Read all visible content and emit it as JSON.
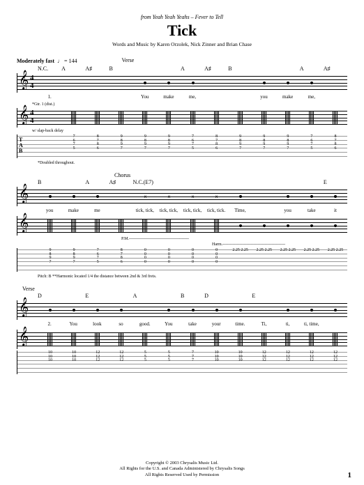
{
  "header": {
    "source": "from Yeah Yeah Yeahs – Fever to Tell",
    "title": "Tick",
    "credits": "Words and Music by Karen Orzolek, Nick Zinner and Brian Chase"
  },
  "tempo": {
    "label": "Moderately fast",
    "bpm": "♩ = 144"
  },
  "systems": [
    {
      "section": "Verse",
      "chords": [
        "N.C.",
        "A",
        "A♯",
        "B",
        "",
        "",
        "A",
        "A♯",
        "B",
        "",
        "",
        "A",
        "A♯"
      ],
      "lyric_prefix": "1.",
      "lyrics": [
        "",
        "",
        "",
        "",
        "You",
        "make",
        "me,",
        "",
        "",
        "you",
        "make",
        "me,",
        ""
      ],
      "perf": "*Gtr. 1 (dist.)",
      "perf2": "w/ slap-back delay",
      "tab_cols": [
        "",
        "7\n6\n7\n5",
        "8\n7\n8\n6",
        "9\n8\n9\n7",
        "9\n8\n9\n7",
        "9\n8\n9\n7",
        "7\n6\n7\n5",
        "8\n7\n8\n6",
        "9\n8\n9\n7",
        "9\n8\n9\n7",
        "9\n8\n9\n7",
        "7\n6\n7\n5",
        "8\n7\n8\n6"
      ],
      "footnote": "*Doubled throughout."
    },
    {
      "section": "Chorus",
      "chords": [
        "B",
        "",
        "A",
        "A♯",
        "N.C.(E7)",
        "",
        "",
        "",
        "",
        "",
        "",
        "",
        "E"
      ],
      "lyrics": [
        "you",
        "make",
        "me",
        "",
        "tick, tick,",
        "tick, tick,",
        "tick, tick,",
        "tick, tick.",
        "Time,",
        "",
        "you",
        "take",
        "it"
      ],
      "perf": "P.M.-------------------------------------------",
      "perf2": "Harm.---------------------------------------------",
      "tab_cols": [
        "9\n8\n9\n7",
        "9\n8\n9\n7",
        "7\n6\n7\n5",
        "8\n7\n8\n6",
        "0\n0\n0\n0",
        "0\n0\n0\n0",
        "0\n0\n0\n0",
        "0\n0\n0\n0",
        "2.25 2.25",
        "2.25 2.25",
        "2.25 2.25",
        "2.25 2.25",
        "2.25 2.25"
      ],
      "footnote": "Pitch: B    **Harmonic located 1/4 the distance between 2nd & 3rd frets."
    },
    {
      "section": "Verse",
      "chords": [
        "D",
        "",
        "E",
        "",
        "A",
        "",
        "B",
        "D",
        "",
        "E",
        "",
        "",
        ""
      ],
      "lyric_prefix": "2.",
      "lyrics": [
        "You",
        "look",
        "so",
        "good.",
        "",
        "You",
        "take",
        "your",
        "time.",
        "",
        "Ti,",
        "ti,",
        "ti,    time,"
      ],
      "tab_cols": [
        "10\n10\n10",
        "10\n10\n10",
        "12\n12\n12",
        "12\n12\n12",
        "5\n5\n5",
        "5\n5\n5",
        "7\n7\n7",
        "10\n10\n10",
        "10\n10\n10",
        "12\n12\n12",
        "12\n12\n12",
        "12\n12\n12",
        "12\n12\n12"
      ]
    }
  ],
  "footer": {
    "line1": "Copyright © 2003 Chrysalis Music Ltd.",
    "line2": "All Rights for the U.S. and Canada Administered by Chrysalis Songs",
    "line3": "All Rights Reserved   Used by Permission"
  },
  "page": "1",
  "labels": {
    "tab": "T\nA\nB"
  }
}
